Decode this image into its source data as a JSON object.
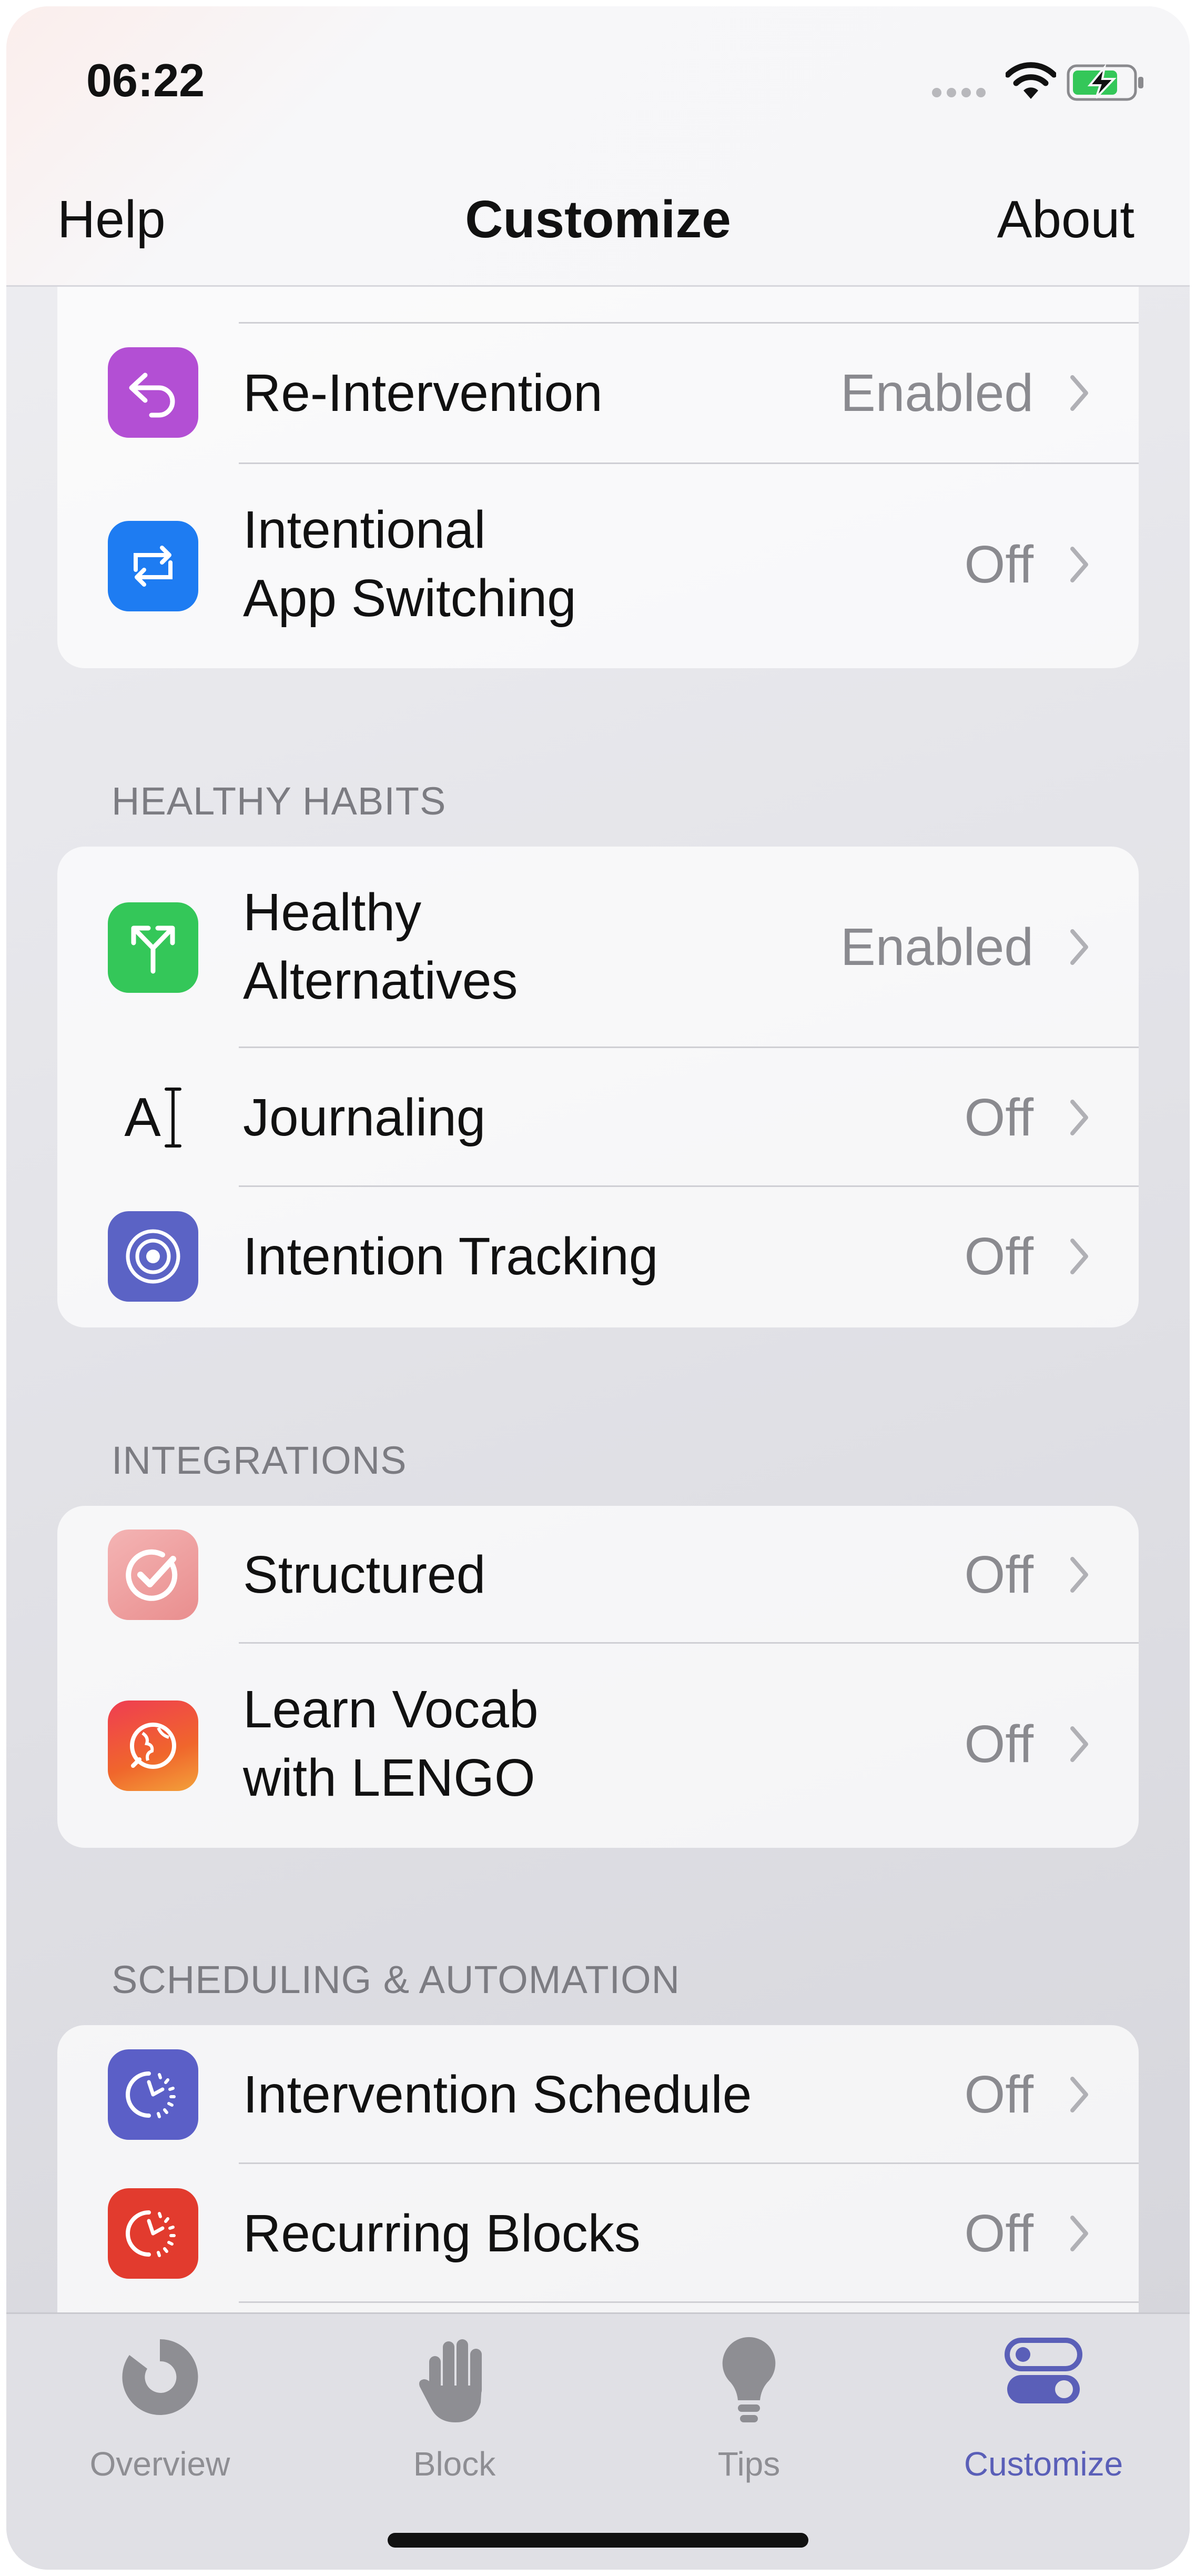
{
  "status": {
    "time": "06:22"
  },
  "nav": {
    "left": "Help",
    "title": "Customize",
    "right": "About"
  },
  "colors": {
    "reintervention": "#b34fd4",
    "app_switching": "#1e7cf2",
    "healthy_alternatives": "#34c759",
    "intention_tracking": "#5b63c5",
    "structured": "#f0a3a3",
    "lengo": "#ec4b2b",
    "schedule": "#5b5fc7",
    "recurring": "#e23b2e",
    "tab_active": "#5a5fb8"
  },
  "group1": {
    "items": [
      {
        "label": "Re-Intervention",
        "value": "Enabled",
        "icon": "undo-arrow-icon"
      },
      {
        "label_line1": "Intentional",
        "label_line2": "App Switching",
        "value": "Off",
        "icon": "app-switch-icon"
      }
    ]
  },
  "healthy_habits": {
    "header": "HEALTHY HABITS",
    "items": [
      {
        "label_line1": "Healthy",
        "label_line2": "Alternatives",
        "value": "Enabled",
        "icon": "fork-arrows-icon"
      },
      {
        "label": "Journaling",
        "value": "Off",
        "icon": "text-cursor-icon",
        "glyph": "A"
      },
      {
        "label": "Intention Tracking",
        "value": "Off",
        "icon": "target-icon"
      }
    ]
  },
  "integrations": {
    "header": "INTEGRATIONS",
    "items": [
      {
        "label": "Structured",
        "value": "Off",
        "icon": "structured-check-icon"
      },
      {
        "label_line1": "Learn Vocab",
        "label_line2": "with LENGO",
        "value": "Off",
        "icon": "lengo-globe-icon"
      }
    ]
  },
  "scheduling": {
    "header": "SCHEDULING & AUTOMATION",
    "items": [
      {
        "label": "Intervention Schedule",
        "value": "Off",
        "icon": "schedule-clock-icon"
      },
      {
        "label": "Recurring Blocks",
        "value": "Off",
        "icon": "recurring-clock-icon"
      }
    ]
  },
  "tabs": [
    {
      "label": "Overview",
      "icon": "donut-chart-icon",
      "active": false
    },
    {
      "label": "Block",
      "icon": "hand-icon",
      "active": false
    },
    {
      "label": "Tips",
      "icon": "lightbulb-icon",
      "active": false
    },
    {
      "label": "Customize",
      "icon": "toggles-icon",
      "active": true
    }
  ]
}
